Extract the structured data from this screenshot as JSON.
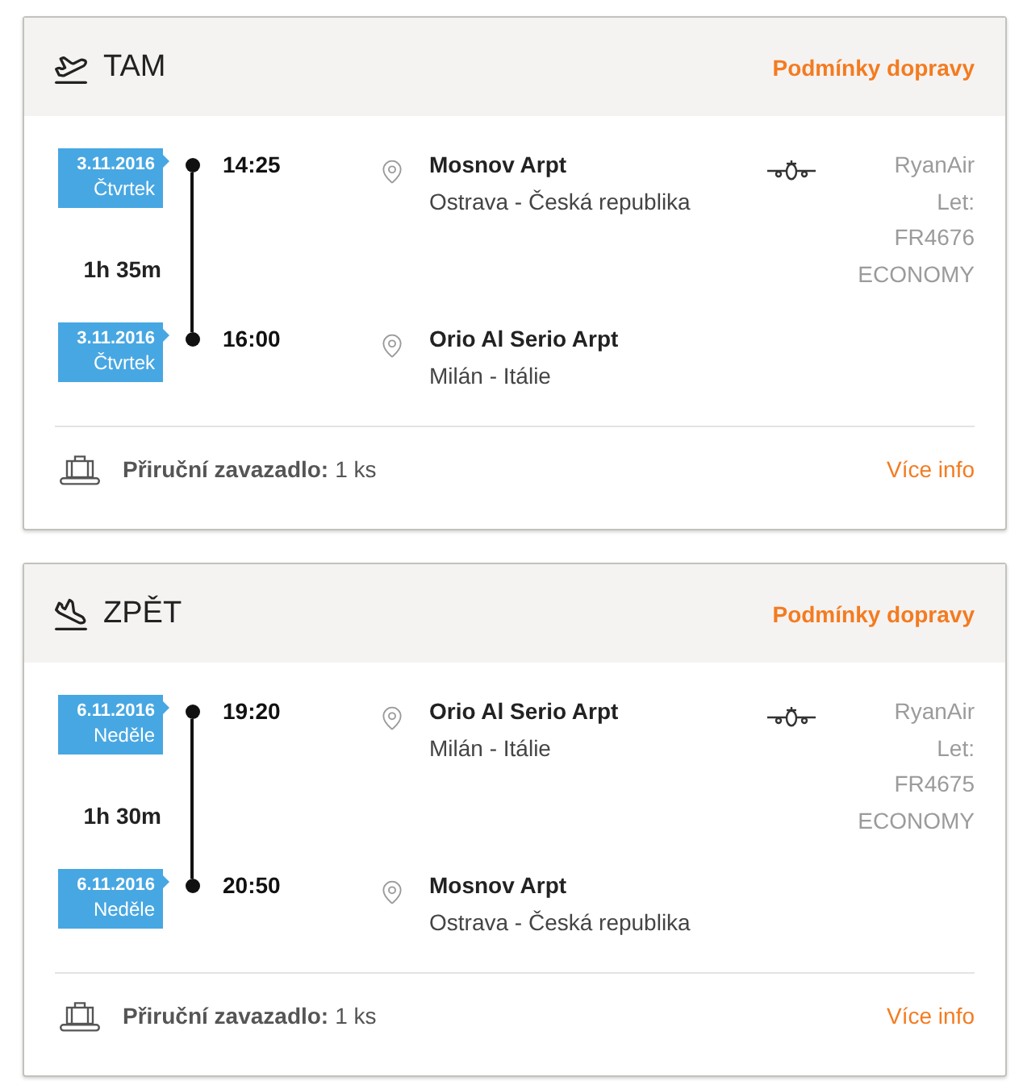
{
  "segments": [
    {
      "kind": "outbound",
      "title": "TAM",
      "conditions_link": "Podmínky dopravy",
      "stops": [
        {
          "date": "3.11.2016",
          "weekday": "Čtvrtek",
          "time": "14:25",
          "airport": "Mosnov Arpt",
          "place": "Ostrava - Česká republika"
        },
        {
          "date": "3.11.2016",
          "weekday": "Čtvrtek",
          "time": "16:00",
          "airport": "Orio Al Serio Arpt",
          "place": "Milán - Itálie"
        }
      ],
      "duration": "1h 35m",
      "flight": {
        "airline": "RyanAir",
        "flight_label": "Let:",
        "flight_number": "FR4676",
        "cabin_class": "ECONOMY"
      },
      "baggage": {
        "label": "Přiruční zavazadlo:",
        "value": "1 ks",
        "link": "Více info"
      }
    },
    {
      "kind": "return",
      "title": "ZPĚT",
      "conditions_link": "Podmínky dopravy",
      "stops": [
        {
          "date": "6.11.2016",
          "weekday": "Neděle",
          "time": "19:20",
          "airport": "Orio Al Serio Arpt",
          "place": "Milán - Itálie"
        },
        {
          "date": "6.11.2016",
          "weekday": "Neděle",
          "time": "20:50",
          "airport": "Mosnov Arpt",
          "place": "Ostrava - Česká republika"
        }
      ],
      "duration": "1h 30m",
      "flight": {
        "airline": "RyanAir",
        "flight_label": "Let:",
        "flight_number": "FR4675",
        "cabin_class": "ECONOMY"
      },
      "baggage": {
        "label": "Přiruční zavazadlo:",
        "value": "1 ks",
        "link": "Více info"
      }
    }
  ]
}
